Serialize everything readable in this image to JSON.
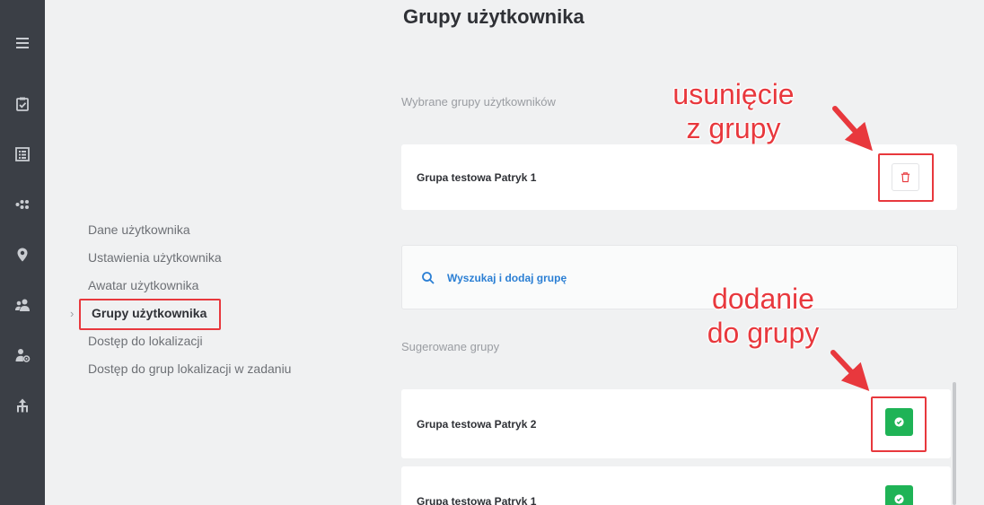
{
  "sidebar_icons": [
    "menu-icon",
    "clipboard-check-icon",
    "list-icon",
    "dots-icon",
    "location-pin-icon",
    "users-icon",
    "user-settings-icon",
    "hierarchy-icon"
  ],
  "page": {
    "title": "Grupy użytkownika"
  },
  "subnav": {
    "items": [
      {
        "label": "Dane użytkownika",
        "active": false
      },
      {
        "label": "Ustawienia użytkownika",
        "active": false
      },
      {
        "label": "Awatar użytkownika",
        "active": false
      },
      {
        "label": "Grupy użytkownika",
        "active": true
      },
      {
        "label": "Dostęp do lokalizacji",
        "active": false
      },
      {
        "label": "Dostęp do grup lokalizacji w zadaniu",
        "active": false
      }
    ]
  },
  "selected": {
    "label": "Wybrane grupy użytkowników",
    "groups": [
      "Grupa testowa Patryk 1"
    ]
  },
  "search": {
    "placeholder": "Wyszukaj i dodaj grupę"
  },
  "suggested": {
    "label": "Sugerowane grupy",
    "groups": [
      "Grupa testowa Patryk 2",
      "Grupa testowa Patryk 1"
    ]
  },
  "annotations": {
    "remove": [
      "usunięcie",
      "z grupy"
    ],
    "add": [
      "dodanie",
      "do grupy"
    ]
  },
  "colors": {
    "accent_red": "#e8383d",
    "add_green": "#1fb356",
    "link_blue": "#2b7fd4",
    "rail": "#3b3f46"
  }
}
